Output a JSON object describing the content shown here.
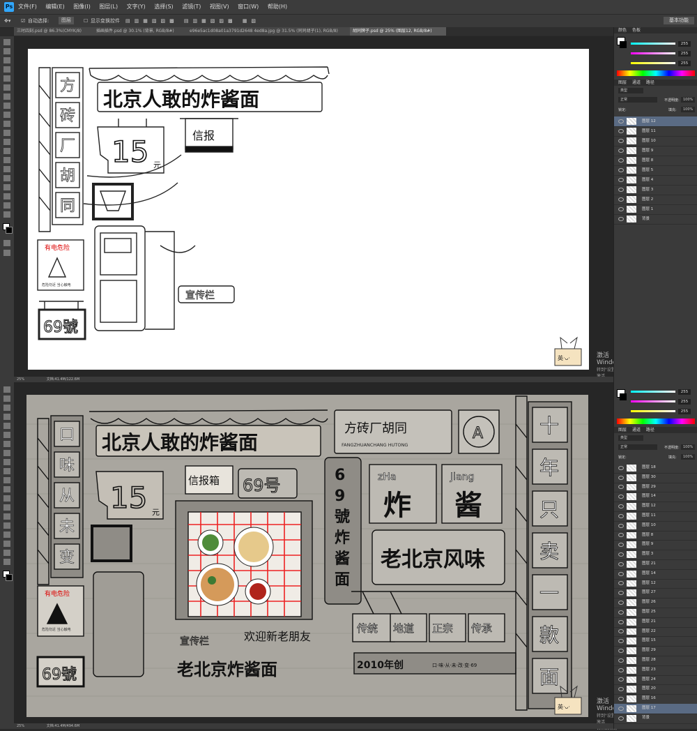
{
  "app": {
    "logo": "Ps",
    "menu": [
      "文件(F)",
      "编辑(E)",
      "图像(I)",
      "图层(L)",
      "文字(Y)",
      "选择(S)",
      "滤镜(T)",
      "视图(V)",
      "窗口(W)",
      "帮助(H)"
    ]
  },
  "options": {
    "auto_select": "自动选择:",
    "layer_dropdown": "图层",
    "show_transform": "显示变换控件",
    "workspace": "基本功能"
  },
  "tabs": [
    "三时四刻.psd @ 86.3%(CMYK/8)",
    "插画插件.psd @ 30.1% (背景, RGB/8#)",
    "e96e5ac1d08a01a3791d2648 4ed8a.jpg @ 31.5% (同同胡子(1), RGB/8)",
    "胡同牌子.psd @ 25% (图层12, RGB/8#)"
  ],
  "status": {
    "top_zoom": "25%",
    "top_doc": "文档:41.4M/122.6M",
    "bottom_zoom": "25%",
    "bottom_doc": "文档:41.4M/494.6M"
  },
  "panel": {
    "color_tab": "颜色",
    "swatch_tab": "色板",
    "r": "255",
    "g": "255",
    "b": "255",
    "layers_tab": "图层",
    "channels_tab": "通道",
    "paths_tab": "路径",
    "kind": "类型",
    "blend": "正常",
    "opacity_label": "不透明度:",
    "opacity": "100%",
    "lock_label": "锁定:",
    "fill_label": "填充:",
    "fill": "100%"
  },
  "top_layers": [
    "图层 12",
    "图层 11",
    "图层 10",
    "图层 9",
    "图层 8",
    "图层 5",
    "图层 4",
    "图层 3",
    "图层 2",
    "图层 1",
    "背景"
  ],
  "bottom_layers": [
    "图层 18",
    "图层 30",
    "图层 29",
    "图层 14",
    "图层 12",
    "图层 11",
    "图层 10",
    "图层 8",
    "图层 9",
    "图层 3",
    "图层 21",
    "图层 14",
    "图层 12",
    "图层 27",
    "图层 26",
    "图层 25",
    "图层 21",
    "图层 22",
    "图层 15",
    "图层 29",
    "图层 28",
    "图层 23",
    "图层 24",
    "图层 20",
    "图层 16",
    "图层 17",
    "背景"
  ],
  "watermark": {
    "title": "激活 Windows",
    "sub": "转到\"设置\"以激活 Windows。"
  },
  "art": {
    "banner": "北京人敢的炸酱面",
    "price": "15",
    "price_unit": "元",
    "mailbox_top": "信报",
    "mailbox_bottom": "信报箱",
    "door_number": "69号",
    "column_left_top": [
      "方",
      "砖",
      "厂",
      "胡",
      "同"
    ],
    "column_left_bottom": [
      "口",
      "味",
      "从",
      "未",
      "变"
    ],
    "danger": "有电危险",
    "danger_sub": "危险勿近 当心触电",
    "plate": "69號",
    "board": "宣传栏",
    "sign_main": "方砖厂胡同",
    "sign_pinyin": "FANGZHUANCHANG HUTONG",
    "vertical_sign": "69號炸酱面",
    "zha_pinyin": "zHa",
    "zha": "炸",
    "jiang_pinyin": "Jiang",
    "jiang": "酱",
    "lao_beijing": "老北京风味",
    "tags": [
      "传统",
      "地道",
      "正宗",
      "传承"
    ],
    "year": "2010年创",
    "slogan": "口·味·从·未·改·变·69",
    "right_column": [
      "十",
      "年",
      "只",
      "卖",
      "一",
      "款",
      "面"
    ],
    "bottom_text1": "欢迎新老朋友",
    "bottom_text2": "老北京炸酱面",
    "badge": "英·ᴗ·"
  }
}
